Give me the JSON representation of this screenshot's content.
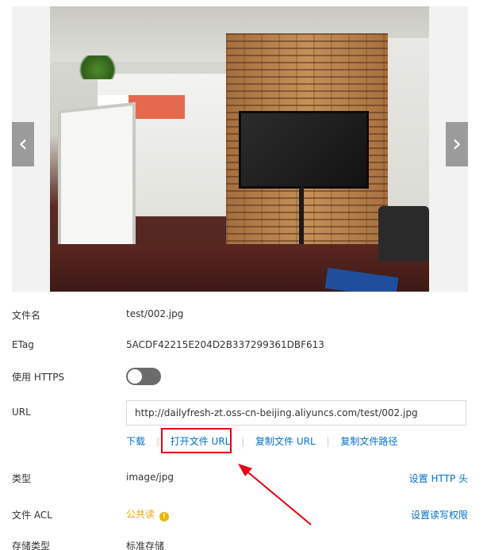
{
  "viewer": {
    "prev_icon": "‹",
    "next_icon": "›"
  },
  "details": {
    "filename_label": "文件名",
    "filename_value": "test/002.jpg",
    "etag_label": "ETag",
    "etag_value": "5ACDF42215E204D2B337299361DBF613",
    "https_label": "使用 HTTPS",
    "https_enabled": false,
    "url_label": "URL",
    "url_value": "http://dailyfresh-zt.oss-cn-beijing.aliyuncs.com/test/002.jpg",
    "type_label": "类型",
    "type_value": "image/jpg",
    "acl_label": "文件 ACL",
    "acl_value": "公共读",
    "storage_label": "存储类型",
    "storage_value": "标准存储"
  },
  "actions": {
    "download": "下载",
    "open_url": "打开文件 URL",
    "copy_url": "复制文件 URL",
    "copy_path": "复制文件路径",
    "separator": "|"
  },
  "links": {
    "set_http_header": "设置 HTTP 头",
    "set_acl": "设置读写权限"
  },
  "colors": {
    "link": "#0070cc",
    "highlight": "#e60012",
    "acl_warning": "#f0a30a"
  }
}
